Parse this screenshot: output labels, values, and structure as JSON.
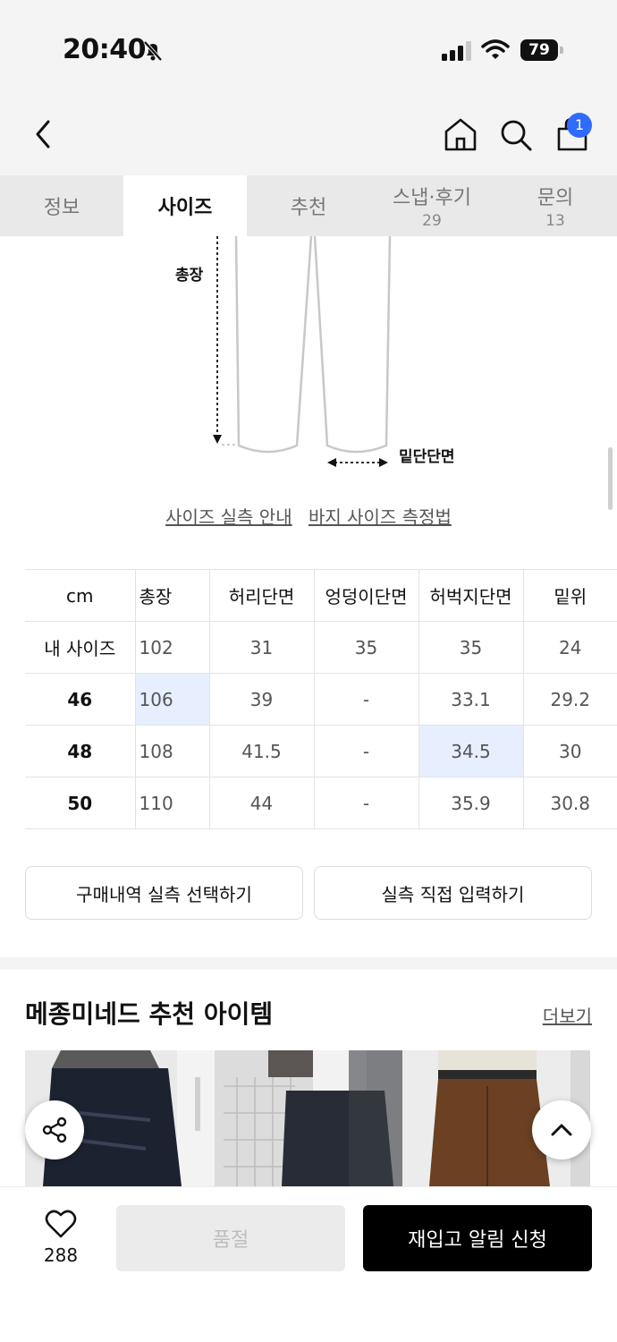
{
  "status_bar": {
    "time": "20:40",
    "battery": "79"
  },
  "header": {
    "cart_count": "1"
  },
  "tabs": [
    {
      "label": "정보",
      "count": ""
    },
    {
      "label": "사이즈",
      "count": ""
    },
    {
      "label": "추천",
      "count": ""
    },
    {
      "label": "스냅·후기",
      "count": "29"
    },
    {
      "label": "문의",
      "count": "13"
    }
  ],
  "diagram": {
    "length_label": "총장",
    "hem_label": "밑단단면"
  },
  "size_guide_links": {
    "actual": "사이즈 실측 안내",
    "measure": "바지 사이즈 측정법"
  },
  "size_table": {
    "headers": [
      "cm",
      "총장",
      "허리단면",
      "엉덩이단면",
      "허벅지단면",
      "밑위"
    ],
    "rows": [
      {
        "label": "내 사이즈",
        "values": [
          "102",
          "31",
          "35",
          "35",
          "24"
        ]
      },
      {
        "label": "46",
        "values": [
          "106",
          "39",
          "-",
          "33.1",
          "29.2"
        ]
      },
      {
        "label": "48",
        "values": [
          "108",
          "41.5",
          "-",
          "34.5",
          "30"
        ]
      },
      {
        "label": "50",
        "values": [
          "110",
          "44",
          "-",
          "35.9",
          "30.8"
        ]
      }
    ]
  },
  "buttons": {
    "purchase_history": "구매내역 실측 선택하기",
    "manual_input": "실측 직접 입력하기"
  },
  "recommend": {
    "title": "메종미네드 추천 아이템",
    "more": "더보기"
  },
  "bottom_bar": {
    "like_count": "288",
    "sold_out": "품절",
    "restock": "재입고 알림 신청"
  }
}
